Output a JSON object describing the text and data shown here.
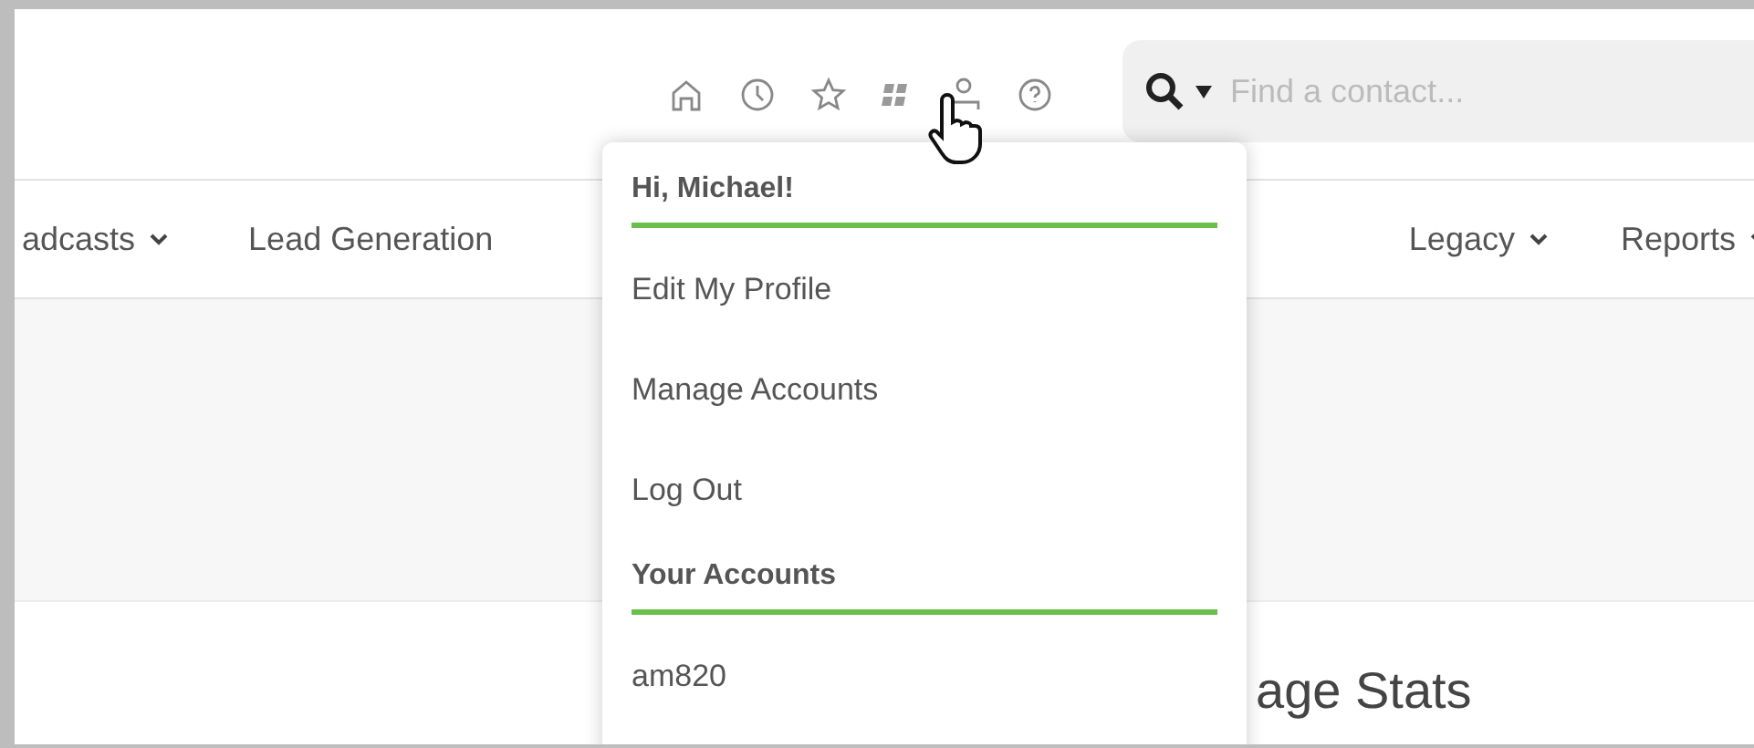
{
  "toolbar": {
    "icons": [
      {
        "kind": "home"
      },
      {
        "kind": "clock"
      },
      {
        "kind": "star"
      },
      {
        "kind": "tiles"
      },
      {
        "kind": "user"
      },
      {
        "kind": "help"
      }
    ],
    "search": {
      "placeholder": "Find a contact..."
    }
  },
  "nav": {
    "left": [
      {
        "label": "adcasts",
        "dropdown": true
      },
      {
        "label": "Lead Generation",
        "dropdown": false
      }
    ],
    "right": [
      {
        "label": "Legacy",
        "dropdown": true
      },
      {
        "label": "Reports",
        "dropdown": true
      }
    ]
  },
  "menu": {
    "sections": [
      {
        "heading": "Hi, Michael!",
        "items": [
          "Edit My Profile",
          "Manage Accounts",
          "Log Out"
        ]
      },
      {
        "heading": "Your Accounts",
        "items": [
          "am820"
        ]
      }
    ]
  },
  "page_heading": "age Stats"
}
